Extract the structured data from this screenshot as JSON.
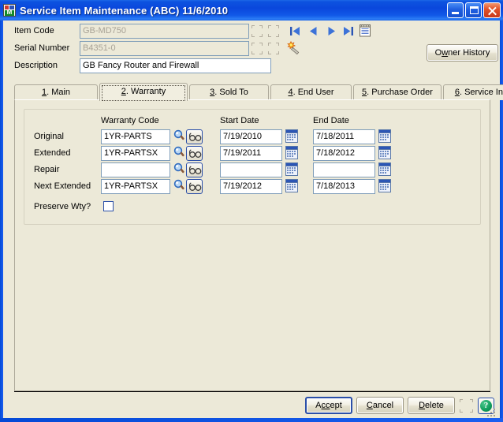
{
  "window": {
    "title": "Service Item Maintenance (ABC) 11/6/2010",
    "icon": "app-icon",
    "icon_letter": "M",
    "minimize_label": "Minimize",
    "maximize_label": "Maximize",
    "close_label": "Close",
    "colors": {
      "titlebar": "#0a47dc",
      "client": "#ece9d8",
      "field_border": "#7f9db9",
      "accent": "#2b4fa8",
      "disabled_text": "#a8a296"
    }
  },
  "header": {
    "fields": [
      {
        "label": "Item Code",
        "value": "GB-MD750",
        "placeholder": "",
        "disabled": true
      },
      {
        "label": "Serial Number",
        "value": "B4351-0",
        "placeholder": "",
        "disabled": true
      },
      {
        "label": "Description",
        "value": "GB Fancy Router and Firewall",
        "placeholder": "",
        "disabled": false
      }
    ],
    "nav": [
      {
        "name": "first-record-button",
        "glyph": "first"
      },
      {
        "name": "previous-record-button",
        "glyph": "previous"
      },
      {
        "name": "next-record-button",
        "glyph": "next"
      },
      {
        "name": "last-record-button",
        "glyph": "last"
      },
      {
        "name": "memo-button",
        "glyph": "memo"
      }
    ],
    "wand_tooltip": "Serial Number Wizard",
    "owner_history": {
      "label_pre": "O",
      "label_acc": "w",
      "label_post": "ner History",
      "full_label": "Owner History"
    }
  },
  "tabs": [
    {
      "num": "1",
      "acc": "1",
      "label": ". Main",
      "selected": false
    },
    {
      "num": "2",
      "acc": "2",
      "label": ". Warranty",
      "selected": true
    },
    {
      "num": "3",
      "acc": "3",
      "label": ". Sold To",
      "selected": false
    },
    {
      "num": "4",
      "acc": "4",
      "label": ". End User",
      "selected": false
    },
    {
      "num": "5",
      "acc": "5",
      "label": ". Purchase Order",
      "selected": false
    },
    {
      "num": "6",
      "acc": "6",
      "label": ". Service Info",
      "selected": false
    }
  ],
  "warranty": {
    "columns": {
      "code": "Warranty Code",
      "start": "Start Date",
      "end": "End Date"
    },
    "rows": [
      {
        "label": "Original",
        "code": "1YR-PARTS",
        "start": "7/19/2010",
        "end": "7/18/2011"
      },
      {
        "label": "Extended",
        "code": "1YR-PARTSX",
        "start": "7/19/2011",
        "end": "7/18/2012"
      },
      {
        "label": "Repair",
        "code": "",
        "start": "",
        "end": ""
      },
      {
        "label": "Next Extended",
        "code": "1YR-PARTSX",
        "start": "7/19/2012",
        "end": "7/18/2013"
      }
    ],
    "preserve": {
      "label": "Preserve Wty?",
      "checked": false
    },
    "lookup_icon": "magnifier-icon",
    "browse_icon": "glasses-icon",
    "calendar_icon": "calendar-icon"
  },
  "footer": {
    "buttons": [
      {
        "name": "accept-button",
        "pre": "A",
        "acc": "cc",
        "post": "ept",
        "full_label": "Accept",
        "focus": true,
        "disabled": false
      },
      {
        "name": "cancel-button",
        "pre": "",
        "acc": "C",
        "post": "ancel",
        "full_label": "Cancel",
        "focus": false,
        "disabled": false
      },
      {
        "name": "delete-button",
        "pre": "",
        "acc": "D",
        "post": "elete",
        "full_label": "Delete",
        "focus": false,
        "disabled": false
      }
    ],
    "extra_button": {
      "name": "print-button",
      "full_label": "",
      "disabled": true
    },
    "help": {
      "glyph": "?",
      "label": "Help"
    }
  }
}
